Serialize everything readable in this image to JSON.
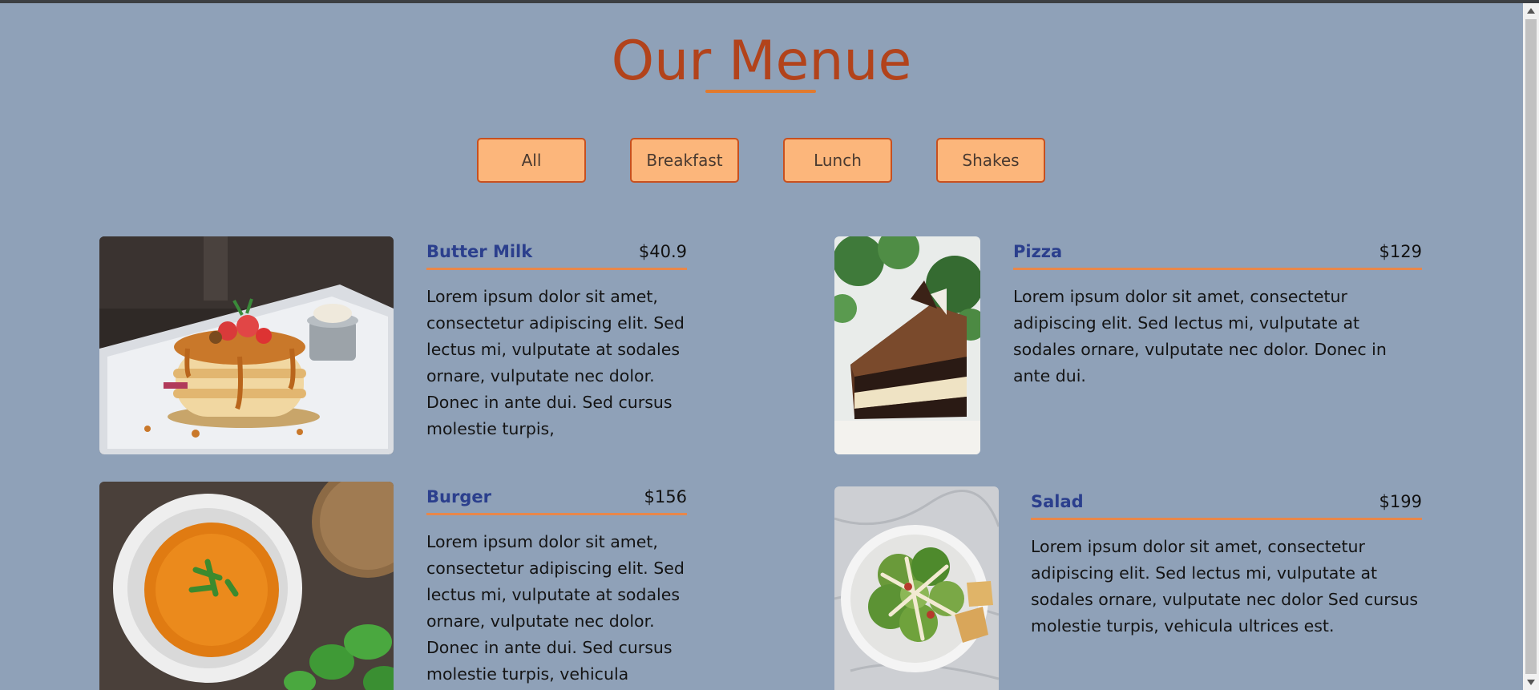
{
  "page": {
    "title": "Our Menue"
  },
  "filters": [
    "All",
    "Breakfast",
    "Lunch",
    "Shakes"
  ],
  "items": [
    {
      "name": "Butter Milk",
      "price": "$40.9",
      "description": "Lorem ipsum dolor sit amet, consectetur adipiscing elit. Sed lectus mi, vulputate at sodales ornare, vulputate nec dolor. Donec in ante dui. Sed cursus molestie turpis,",
      "image": "pancake-stack-photo"
    },
    {
      "name": "Pizza",
      "price": "$129",
      "description": "Lorem ipsum dolor sit amet, consectetur adipiscing elit. Sed lectus mi, vulputate at sodales ornare, vulputate nec dolor. Donec in ante dui.",
      "image": "chocolate-cake-slice-photo"
    },
    {
      "name": "Burger",
      "price": "$156",
      "description": "Lorem ipsum dolor sit amet, consectetur adipiscing elit. Sed lectus mi, vulputate at sodales ornare, vulputate nec dolor. Donec in ante dui. Sed cursus molestie turpis, vehicula ultrices",
      "image": "tomato-soup-bowl-photo"
    },
    {
      "name": "Salad",
      "price": "$199",
      "description": "Lorem ipsum dolor sit amet, consectetur adipiscing elit. Sed lectus mi, vulputate at sodales ornare, vulputate nec dolor Sed cursus molestie turpis, vehicula ultrices est.",
      "image": "caesar-salad-photo"
    }
  ],
  "colors": {
    "background": "#8fa1b8",
    "title": "#b2431b",
    "accent": "#e07a2e",
    "button_fill": "#fcb67b",
    "button_border": "#c7501f",
    "item_name": "#2b3f8d"
  }
}
